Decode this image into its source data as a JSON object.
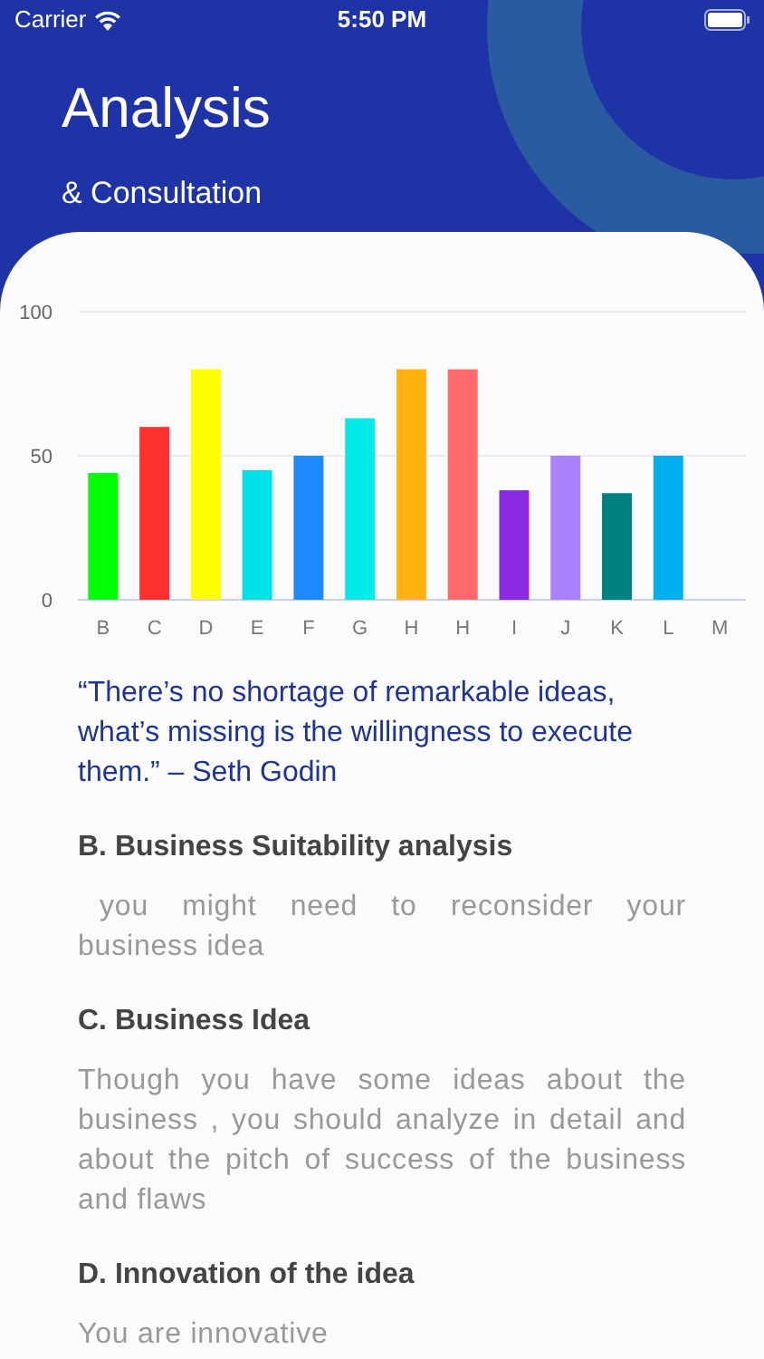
{
  "status_bar": {
    "carrier": "Carrier",
    "time": "5:50 PM"
  },
  "header": {
    "title": "Analysis",
    "subtitle": "& Consultation"
  },
  "chart_data": {
    "type": "bar",
    "categories": [
      "B",
      "C",
      "D",
      "E",
      "F",
      "G",
      "H",
      "H",
      "I",
      "J",
      "K",
      "L",
      "M"
    ],
    "ylim": [
      0,
      100
    ],
    "yticks": [
      0,
      50,
      100
    ],
    "series": [
      {
        "color": "#00ff00",
        "values": [
          44,
          null,
          null,
          null,
          null,
          null,
          null,
          null,
          null,
          null,
          null,
          null,
          null
        ]
      },
      {
        "color": "#ff3030",
        "values": [
          null,
          60,
          null,
          null,
          null,
          null,
          null,
          null,
          null,
          null,
          null,
          null,
          null
        ]
      },
      {
        "color": "#ffff00",
        "values": [
          null,
          null,
          80,
          null,
          null,
          null,
          null,
          null,
          null,
          null,
          null,
          null,
          null
        ]
      },
      {
        "color": "#00e0e8",
        "values": [
          null,
          null,
          null,
          45,
          null,
          null,
          null,
          null,
          null,
          null,
          null,
          null,
          null
        ]
      },
      {
        "color": "#1e88ff",
        "values": [
          null,
          null,
          null,
          null,
          50,
          null,
          null,
          null,
          null,
          null,
          null,
          null,
          null
        ]
      },
      {
        "color": "#00eaea",
        "values": [
          null,
          null,
          null,
          null,
          null,
          63,
          null,
          null,
          null,
          null,
          null,
          null,
          null
        ]
      },
      {
        "color": "#ffb311",
        "values": [
          null,
          null,
          null,
          null,
          null,
          null,
          80,
          null,
          null,
          null,
          null,
          null,
          null
        ]
      },
      {
        "color": "#ff6b6b",
        "values": [
          null,
          null,
          null,
          null,
          null,
          null,
          null,
          80,
          null,
          null,
          null,
          null,
          null
        ]
      },
      {
        "color": "#8a2be2",
        "values": [
          null,
          null,
          null,
          null,
          null,
          null,
          null,
          null,
          38,
          null,
          null,
          null,
          null
        ]
      },
      {
        "color": "#a981ff",
        "values": [
          null,
          null,
          null,
          null,
          null,
          null,
          null,
          null,
          null,
          50,
          null,
          null,
          null
        ]
      },
      {
        "color": "#008080",
        "values": [
          null,
          null,
          null,
          null,
          null,
          null,
          null,
          null,
          null,
          null,
          37,
          null,
          null
        ]
      },
      {
        "color": "#00b0ee",
        "values": [
          null,
          null,
          null,
          null,
          null,
          null,
          null,
          null,
          null,
          null,
          null,
          50,
          null
        ]
      }
    ]
  },
  "quote": "“There’s no shortage of remarkable ideas, what’s missing is the willingness to execute them.” – Seth Godin",
  "sections": [
    {
      "heading": "B. Business Suitability analysis",
      "body": "you might need to reconsider your business idea",
      "indented": true
    },
    {
      "heading": "C. Business Idea",
      "body": "Though you have some ideas about the business , you should analyze in detail and about the pitch of success of the business and flaws",
      "indented": false
    },
    {
      "heading": "D. Innovation of the idea",
      "body": "You are innovative",
      "indented": false
    }
  ]
}
